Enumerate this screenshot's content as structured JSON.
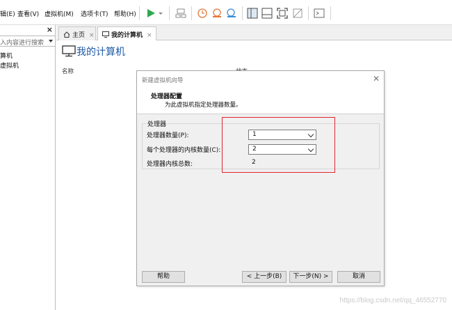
{
  "menubar": {
    "items": [
      "辑(E)",
      "查看(V)",
      "虚拟机(M)",
      "选项卡(T)",
      "帮助(H)"
    ]
  },
  "library": {
    "search_placeholder": "入内容进行搜索",
    "tree": [
      "算机",
      "虚拟机"
    ]
  },
  "tabs": [
    {
      "label": "主页",
      "icon": "home-icon"
    },
    {
      "label": "我的计算机",
      "icon": "monitor-icon"
    }
  ],
  "main": {
    "title": "我的计算机",
    "columns": [
      "名称",
      "状态"
    ]
  },
  "dialog": {
    "title": "新建虚拟机向导",
    "heading": "处理器配置",
    "subheading": "为此虚拟机指定处理器数量。",
    "group_label": "处理器",
    "fields": [
      {
        "label": "处理器数量(P):",
        "value": "1"
      },
      {
        "label": "每个处理器的内核数量(C):",
        "value": "2"
      },
      {
        "label": "处理器内核总数:",
        "value": "2"
      }
    ],
    "buttons": {
      "help": "帮助",
      "back": "< 上一步(B)",
      "next": "下一步(N) >",
      "cancel": "取消"
    }
  },
  "colors": {
    "highlight": "#e0262e",
    "title_blue": "#1e5aa8",
    "play_green": "#2fa84f"
  },
  "watermark": "https://blog.csdn.net/qq_46552770"
}
